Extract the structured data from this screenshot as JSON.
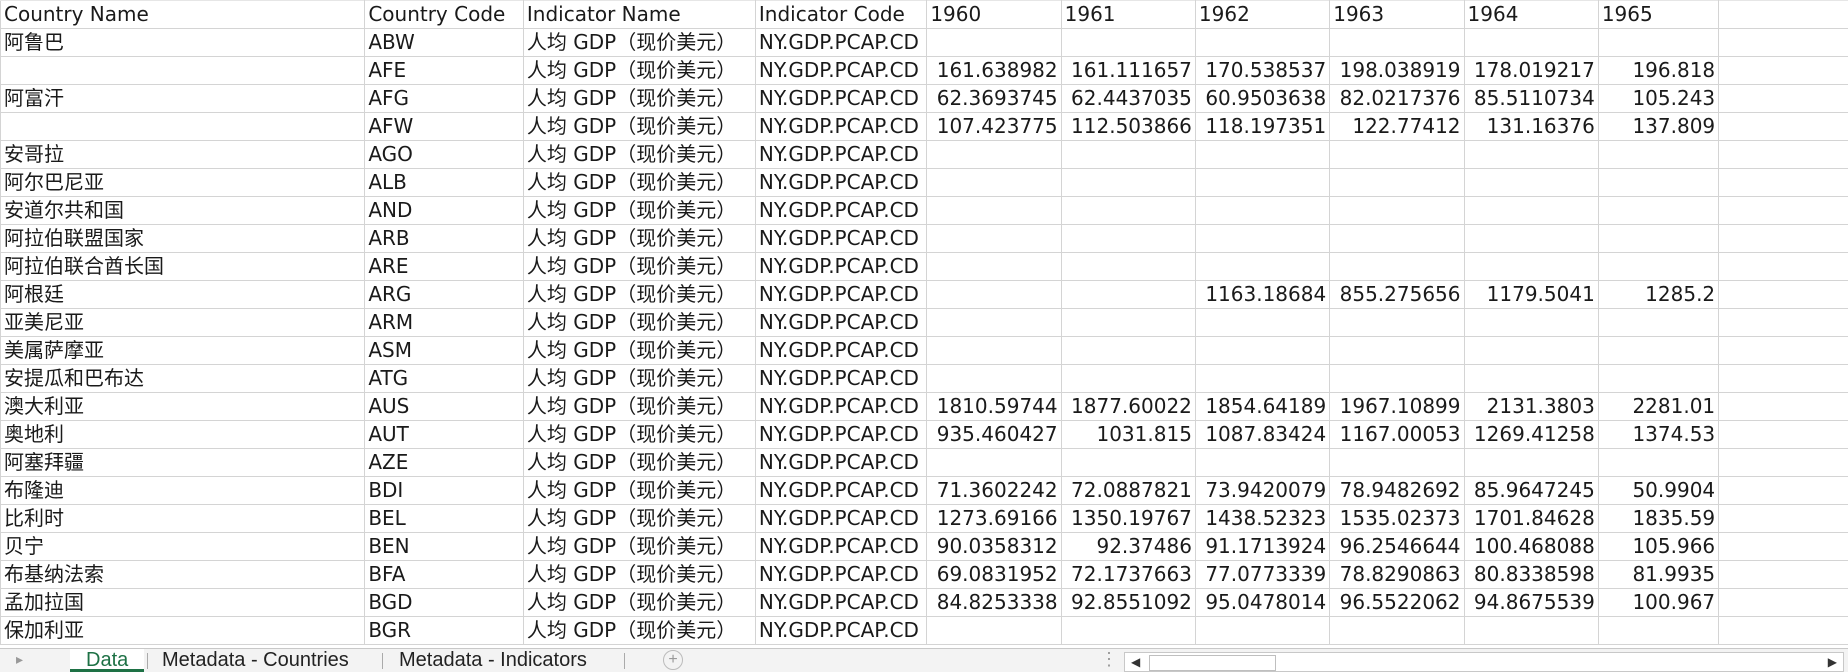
{
  "columns": [
    "Country Name",
    "Country Code",
    "Indicator Name",
    "Indicator Code",
    "1960",
    "1961",
    "1962",
    "1963",
    "1964",
    "1965"
  ],
  "rows": [
    [
      "阿鲁巴",
      "ABW",
      "人均 GDP（现价美元）",
      "NY.GDP.PCAP.CD",
      "",
      "",
      "",
      "",
      "",
      ""
    ],
    [
      "",
      "AFE",
      "人均 GDP（现价美元）",
      "NY.GDP.PCAP.CD",
      "161.638982",
      "161.111657",
      "170.538537",
      "198.038919",
      "178.019217",
      "196.818"
    ],
    [
      "阿富汗",
      "AFG",
      "人均 GDP（现价美元）",
      "NY.GDP.PCAP.CD",
      "62.3693745",
      "62.4437035",
      "60.9503638",
      "82.0217376",
      "85.5110734",
      "105.243"
    ],
    [
      "",
      "AFW",
      "人均 GDP（现价美元）",
      "NY.GDP.PCAP.CD",
      "107.423775",
      "112.503866",
      "118.197351",
      "122.77412",
      "131.16376",
      "137.809"
    ],
    [
      "安哥拉",
      "AGO",
      "人均 GDP（现价美元）",
      "NY.GDP.PCAP.CD",
      "",
      "",
      "",
      "",
      "",
      ""
    ],
    [
      "阿尔巴尼亚",
      "ALB",
      "人均 GDP（现价美元）",
      "NY.GDP.PCAP.CD",
      "",
      "",
      "",
      "",
      "",
      ""
    ],
    [
      "安道尔共和国",
      "AND",
      "人均 GDP（现价美元）",
      "NY.GDP.PCAP.CD",
      "",
      "",
      "",
      "",
      "",
      ""
    ],
    [
      "阿拉伯联盟国家",
      "ARB",
      "人均 GDP（现价美元）",
      "NY.GDP.PCAP.CD",
      "",
      "",
      "",
      "",
      "",
      ""
    ],
    [
      "阿拉伯联合酋长国",
      "ARE",
      "人均 GDP（现价美元）",
      "NY.GDP.PCAP.CD",
      "",
      "",
      "",
      "",
      "",
      ""
    ],
    [
      "阿根廷",
      "ARG",
      "人均 GDP（现价美元）",
      "NY.GDP.PCAP.CD",
      "",
      "",
      "1163.18684",
      "855.275656",
      "1179.5041",
      "1285.2"
    ],
    [
      "亚美尼亚",
      "ARM",
      "人均 GDP（现价美元）",
      "NY.GDP.PCAP.CD",
      "",
      "",
      "",
      "",
      "",
      ""
    ],
    [
      "美属萨摩亚",
      "ASM",
      "人均 GDP（现价美元）",
      "NY.GDP.PCAP.CD",
      "",
      "",
      "",
      "",
      "",
      ""
    ],
    [
      "安提瓜和巴布达",
      "ATG",
      "人均 GDP（现价美元）",
      "NY.GDP.PCAP.CD",
      "",
      "",
      "",
      "",
      "",
      ""
    ],
    [
      "澳大利亚",
      "AUS",
      "人均 GDP（现价美元）",
      "NY.GDP.PCAP.CD",
      "1810.59744",
      "1877.60022",
      "1854.64189",
      "1967.10899",
      "2131.3803",
      "2281.01"
    ],
    [
      "奥地利",
      "AUT",
      "人均 GDP（现价美元）",
      "NY.GDP.PCAP.CD",
      "935.460427",
      "1031.815",
      "1087.83424",
      "1167.00053",
      "1269.41258",
      "1374.53"
    ],
    [
      "阿塞拜疆",
      "AZE",
      "人均 GDP（现价美元）",
      "NY.GDP.PCAP.CD",
      "",
      "",
      "",
      "",
      "",
      ""
    ],
    [
      "布隆迪",
      "BDI",
      "人均 GDP（现价美元）",
      "NY.GDP.PCAP.CD",
      "71.3602242",
      "72.0887821",
      "73.9420079",
      "78.9482692",
      "85.9647245",
      "50.9904"
    ],
    [
      "比利时",
      "BEL",
      "人均 GDP（现价美元）",
      "NY.GDP.PCAP.CD",
      "1273.69166",
      "1350.19767",
      "1438.52323",
      "1535.02373",
      "1701.84628",
      "1835.59"
    ],
    [
      "贝宁",
      "BEN",
      "人均 GDP（现价美元）",
      "NY.GDP.PCAP.CD",
      "90.0358312",
      "92.37486",
      "91.1713924",
      "96.2546644",
      "100.468088",
      "105.966"
    ],
    [
      "布基纳法索",
      "BFA",
      "人均 GDP（现价美元）",
      "NY.GDP.PCAP.CD",
      "69.0831952",
      "72.1737663",
      "77.0773339",
      "78.8290863",
      "80.8338598",
      "81.9935"
    ],
    [
      "孟加拉国",
      "BGD",
      "人均 GDP（现价美元）",
      "NY.GDP.PCAP.CD",
      "84.8253338",
      "92.8551092",
      "95.0478014",
      "96.5522062",
      "94.8675539",
      "100.967"
    ],
    [
      "保加利亚",
      "BGR",
      "人均 GDP（现价美元）",
      "NY.GDP.PCAP.CD",
      "",
      "",
      "",
      "",
      "",
      ""
    ]
  ],
  "tabs": [
    "Data",
    "Metadata - Countries",
    "Metadata - Indicators"
  ],
  "active_tab": "Data",
  "icons": {
    "add_sheet": "plus-circle-icon",
    "scroll_left": "triangle-left-icon",
    "scroll_right": "triangle-right-icon",
    "more": "vertical-dots-icon"
  }
}
